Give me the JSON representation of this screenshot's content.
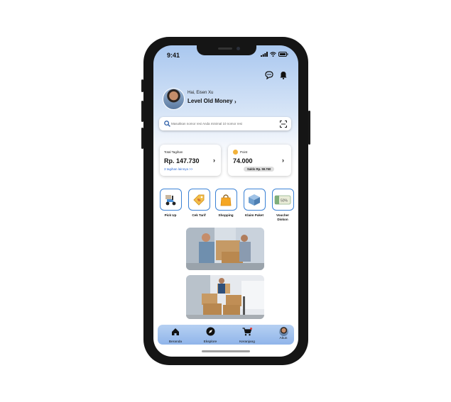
{
  "status": {
    "time": "9:41"
  },
  "user": {
    "greeting": "Hai, Eisen Xu",
    "level": "Level Old Money"
  },
  "search": {
    "placeholder": "Masukkan nomor resi Anda minimal 10 nomor resi"
  },
  "cards": {
    "total": {
      "label": "Total Tagihan",
      "value": "Rp. 147.730",
      "link": "3 tagihan lainnya >>"
    },
    "point": {
      "label": "Point",
      "value": "74.000",
      "saldo": "Saldo Rp. 59.760"
    }
  },
  "services": [
    {
      "label": "Pick Up",
      "icon": "scooter-icon"
    },
    {
      "label": "Cek Tarif",
      "icon": "price-tag-icon"
    },
    {
      "label": "Shopping",
      "icon": "shopping-bag-icon"
    },
    {
      "label": "Klaim Paket",
      "icon": "package-box-icon"
    },
    {
      "label": "Voucher Diskon",
      "icon": "voucher-icon"
    }
  ],
  "voucher_text": "50%",
  "nav": [
    {
      "label": "Beranda",
      "icon": "home-icon"
    },
    {
      "label": "Eksplore",
      "icon": "compass-icon"
    },
    {
      "label": "Keranjang",
      "icon": "cart-icon"
    },
    {
      "label": "Akun",
      "icon": "avatar-icon"
    }
  ],
  "colors": {
    "accent": "#3b82d6",
    "link": "#2d6bd6",
    "nav_bg": "#a3c3ee",
    "coin": "#f2b23a"
  }
}
